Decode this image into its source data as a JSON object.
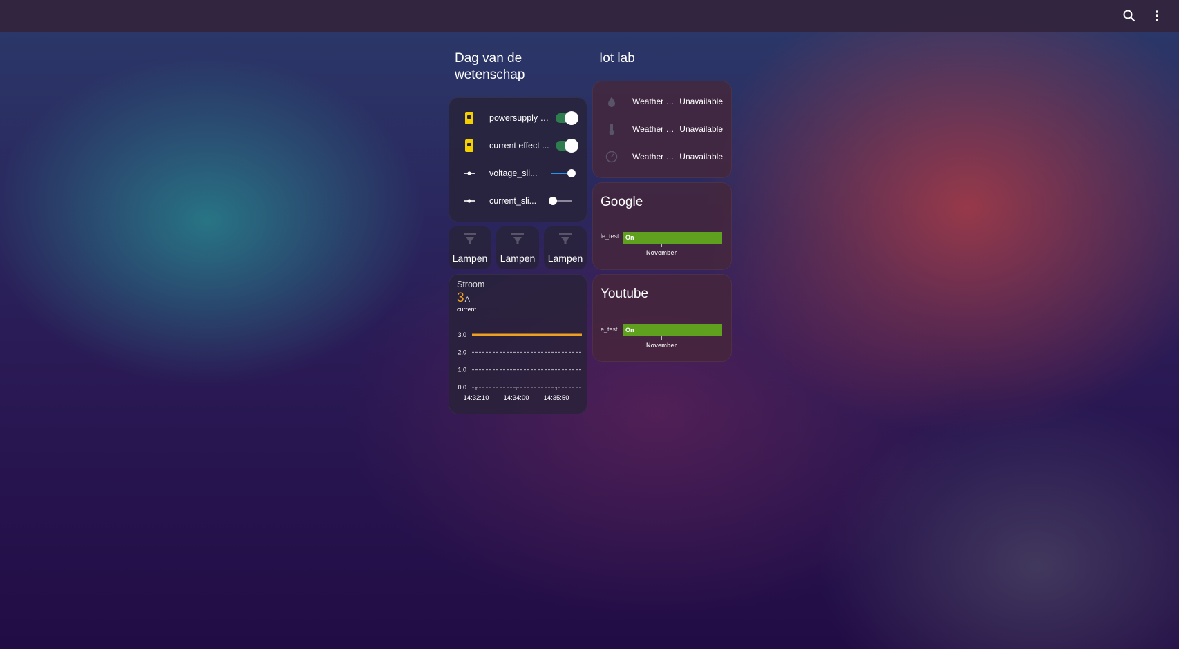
{
  "topbar": {
    "icons": [
      "search-icon",
      "more-vertical-icon"
    ]
  },
  "colors": {
    "accent_orange": "#f0a020",
    "toggle_on": "#2e7d4f",
    "timeline_on": "#5fa11e",
    "slider_active": "#2196f3",
    "plug_yellow": "#f5d000"
  },
  "left_column": {
    "title": "Dag van de wetenschap",
    "entities": [
      {
        "icon": "power-plug-icon",
        "label": "powersupply s...",
        "control": "toggle",
        "state": "on"
      },
      {
        "icon": "power-plug-icon",
        "label": "current effect ...",
        "control": "toggle",
        "state": "on"
      },
      {
        "icon": "slider-icon",
        "label": "voltage_sli...",
        "control": "slider",
        "value": 0.95
      },
      {
        "icon": "slider-icon",
        "label": "current_sli...",
        "control": "slider",
        "value": 0.05
      }
    ],
    "lamps": [
      {
        "icon": "ceiling-light-icon",
        "label": "Lampen"
      },
      {
        "icon": "ceiling-light-icon",
        "label": "Lampen"
      },
      {
        "icon": "ceiling-light-icon",
        "label": "Lampen"
      }
    ],
    "sensor_card": {
      "name": "Stroom",
      "value": "3",
      "unit": "A",
      "attribute": "current"
    }
  },
  "right_column": {
    "title": "Iot lab",
    "sensors": [
      {
        "icon": "water-drop-icon",
        "name": "Weather s...",
        "state": "Unavailable"
      },
      {
        "icon": "thermometer-icon",
        "name": "Weather s...",
        "state": "Unavailable"
      },
      {
        "icon": "gauge-icon",
        "name": "Weather s...",
        "state": "Unavailable"
      }
    ],
    "timelines": [
      {
        "title": "Google",
        "entity": "le_test",
        "state": "On",
        "axis_label": "November"
      },
      {
        "title": "Youtube",
        "entity": "e_test",
        "state": "On",
        "axis_label": "November"
      }
    ]
  },
  "chart_data": {
    "type": "line",
    "title": "",
    "xlabel": "",
    "ylabel": "",
    "x_ticks": [
      "14:32:10",
      "14:34:00",
      "14:35:50"
    ],
    "y_ticks": [
      "0.0",
      "1.0",
      "2.0",
      "3.0"
    ],
    "ylim": [
      0,
      3
    ],
    "grid": true,
    "series": [
      {
        "values": [
          3,
          3,
          3,
          3,
          3,
          3,
          3
        ],
        "color": "#f0a020"
      }
    ]
  }
}
